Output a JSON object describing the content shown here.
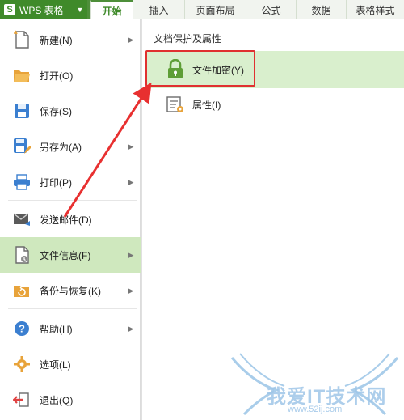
{
  "app": {
    "logo": "S",
    "title": "WPS 表格"
  },
  "tabs": [
    {
      "label": "开始",
      "active": true
    },
    {
      "label": "插入"
    },
    {
      "label": "页面布局"
    },
    {
      "label": "公式"
    },
    {
      "label": "数据"
    },
    {
      "label": "表格样式"
    }
  ],
  "menu": {
    "items": [
      {
        "label": "新建(N)",
        "icon": "new-document-icon"
      },
      {
        "label": "打开(O)",
        "icon": "open-folder-icon"
      },
      {
        "label": "保存(S)",
        "icon": "save-icon"
      },
      {
        "label": "另存为(A)",
        "icon": "save-as-icon"
      },
      {
        "label": "打印(P)",
        "icon": "print-icon"
      },
      {
        "label": "发送邮件(D)",
        "icon": "mail-icon"
      },
      {
        "label": "文件信息(F)",
        "icon": "file-info-icon",
        "active": true
      },
      {
        "label": "备份与恢复(K)",
        "icon": "backup-icon"
      },
      {
        "label": "帮助(H)",
        "icon": "help-icon"
      },
      {
        "label": "选项(L)",
        "icon": "options-icon"
      },
      {
        "label": "退出(Q)",
        "icon": "exit-icon"
      }
    ]
  },
  "submenu": {
    "title": "文档保护及属性",
    "items": [
      {
        "label": "文件加密(Y)",
        "icon": "lock-icon"
      },
      {
        "label": "属性(I)",
        "icon": "properties-icon"
      }
    ]
  },
  "watermark": {
    "text": "我爱IT技术网",
    "url": "www.52ij.com"
  },
  "colors": {
    "brand": "#4e8f3a",
    "highlight": "#d9efcd",
    "active_row": "#cfe8be",
    "annotation": "#e03030"
  }
}
